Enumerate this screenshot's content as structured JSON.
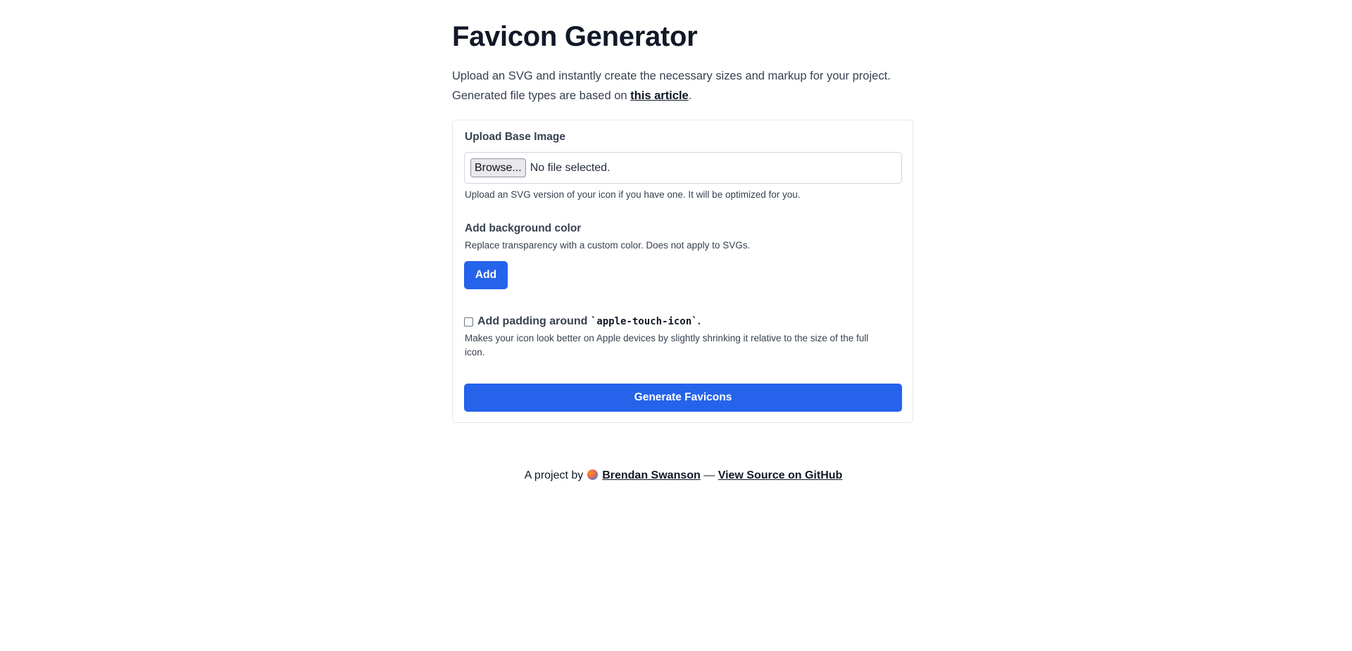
{
  "header": {
    "title": "Favicon Generator",
    "intro_line1": "Upload an SVG and instantly create the necessary sizes and markup for your project.",
    "intro_line2_prefix": "Generated file types are based on ",
    "intro_link": "this article",
    "intro_line2_suffix": "."
  },
  "upload": {
    "label": "Upload Base Image",
    "browse_label": "Browse...",
    "file_status": "No file selected.",
    "help": "Upload an SVG version of your icon if you have one. It will be optimized for you."
  },
  "background": {
    "label": "Add background color",
    "help": "Replace transparency with a custom color. Does not apply to SVGs.",
    "add_label": "Add"
  },
  "padding": {
    "checked": false,
    "label_prefix": "Add padding around ",
    "label_code": "`apple-touch-icon`",
    "label_suffix": ".",
    "help": "Makes your icon look better on Apple devices by slightly shrinking it relative to the size of the full icon."
  },
  "actions": {
    "generate_label": "Generate Favicons"
  },
  "footer": {
    "prefix": "A project by",
    "author": "Brendan Swanson",
    "separator": "—",
    "source_link": "View Source on GitHub"
  },
  "colors": {
    "accent": "#2563eb",
    "text": "#374151",
    "border": "#e5e7eb"
  }
}
